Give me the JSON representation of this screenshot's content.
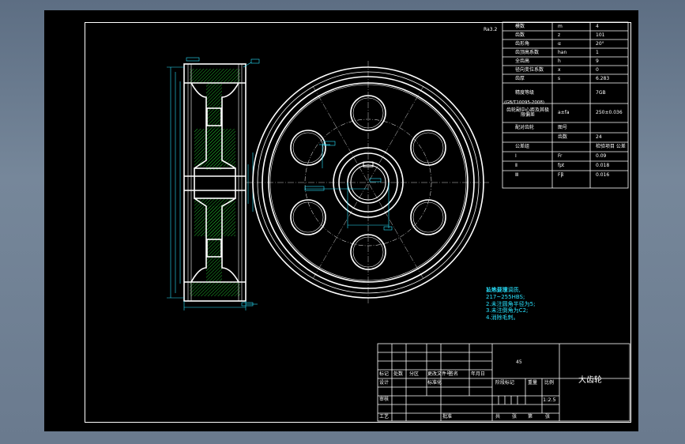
{
  "params": {
    "rows": [
      {
        "label": "模数",
        "sym": "m",
        "val": "4"
      },
      {
        "label": "齿数",
        "sym": "z",
        "val": "101"
      },
      {
        "label": "齿形角",
        "sym": "α",
        "val": "20°"
      },
      {
        "label": "齿顶高系数",
        "sym": "han",
        "val": "1"
      },
      {
        "label": "全齿高",
        "sym": "h",
        "val": "9"
      },
      {
        "label": "径向变位系数",
        "sym": "x",
        "val": "0"
      },
      {
        "label": "齿厚",
        "sym": "s",
        "val": "6.283"
      },
      {
        "label": "精度等级",
        "sym": "",
        "val": "7GB"
      },
      {
        "label": "齿轮副中心距及其极限偏差",
        "sym": "a±fa",
        "val": "250±0.036"
      },
      {
        "label": "配对齿轮",
        "sym": "图号",
        "val": ""
      },
      {
        "label": "",
        "sym": "齿数",
        "val": "24"
      },
      {
        "label": "公差组",
        "sym": "",
        "val": "检验项目 公差"
      },
      {
        "label": "Ⅰ",
        "sym": "Fr",
        "val": "0.09"
      },
      {
        "label": "Ⅱ",
        "sym": "fpt",
        "val": "0.018"
      },
      {
        "label": "Ⅲ",
        "sym": "Fβ",
        "val": "0.016"
      }
    ],
    "standard": "(GB/T10095-2008)"
  },
  "roughness": "Ra3.2",
  "notes": {
    "title": "技术要求",
    "items": [
      "1.热处理调质,",
      "217~255HBS;",
      "2.未注圆角半径为5;",
      "3.未注倒角为C2;",
      "4.消除毛刺。"
    ]
  },
  "title_block": {
    "part_name": "大齿轮",
    "material": "45",
    "scale": "1:2.5",
    "headers": [
      "标记",
      "处数",
      "分区",
      "更改文件号",
      "签名",
      "年月日"
    ],
    "row2": [
      "设计",
      "",
      "标准化",
      "",
      "",
      "阶段标记",
      "重量",
      "比例"
    ],
    "row3": [
      "审核"
    ],
    "row4": [
      "工艺",
      "",
      "批准"
    ],
    "bottom": [
      "共",
      "张",
      "第",
      "张"
    ]
  }
}
